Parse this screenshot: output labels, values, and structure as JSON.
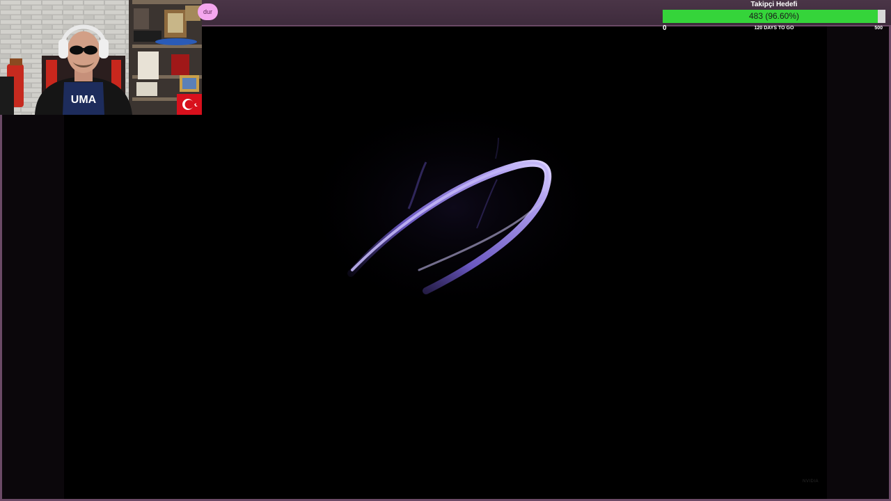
{
  "webcam": {
    "pill_text": "dur"
  },
  "goal": {
    "title": "Takipçi Hedefi",
    "current": 483,
    "target": 500,
    "min": "0",
    "max": "500",
    "value_text": "483 (96.60%)",
    "progress": 0.966,
    "days_text": "120 DAYS TO GO",
    "fill_color": "#35d43a"
  },
  "video": {
    "watermark": "NVIDIA"
  },
  "colors": {
    "frame": "#6b4a66",
    "top_bar": "#4a3547",
    "pill": "#f4a6ee"
  }
}
